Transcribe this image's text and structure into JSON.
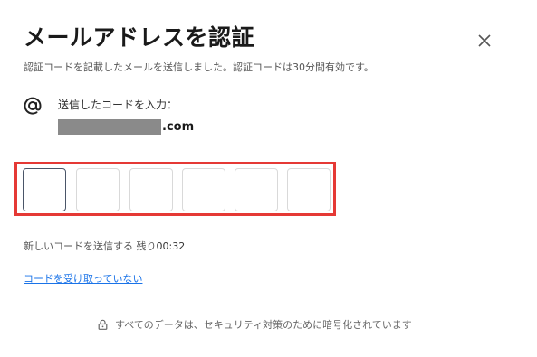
{
  "dialog": {
    "title": "メールアドレスを認証",
    "subtitle": "認証コードを記載したメールを送信しました。認証コードは30分間有効です。",
    "close_icon": "close-icon"
  },
  "recipient": {
    "icon": "at-sign-icon",
    "prompt": "送信したコードを入力：",
    "email_domain": ".com"
  },
  "code_input": {
    "length": 6,
    "values": [
      "",
      "",
      "",
      "",
      "",
      ""
    ]
  },
  "resend": {
    "label": "新しいコードを送信する",
    "remaining_label": "残り",
    "timer": "00:32"
  },
  "help_link": "コードを受け取っていない",
  "footer": {
    "icon": "lock-icon",
    "text": "すべてのデータは、セキュリティ対策のために暗号化されています"
  },
  "colors": {
    "highlight_border": "#e53935",
    "link": "#1a73e8"
  }
}
